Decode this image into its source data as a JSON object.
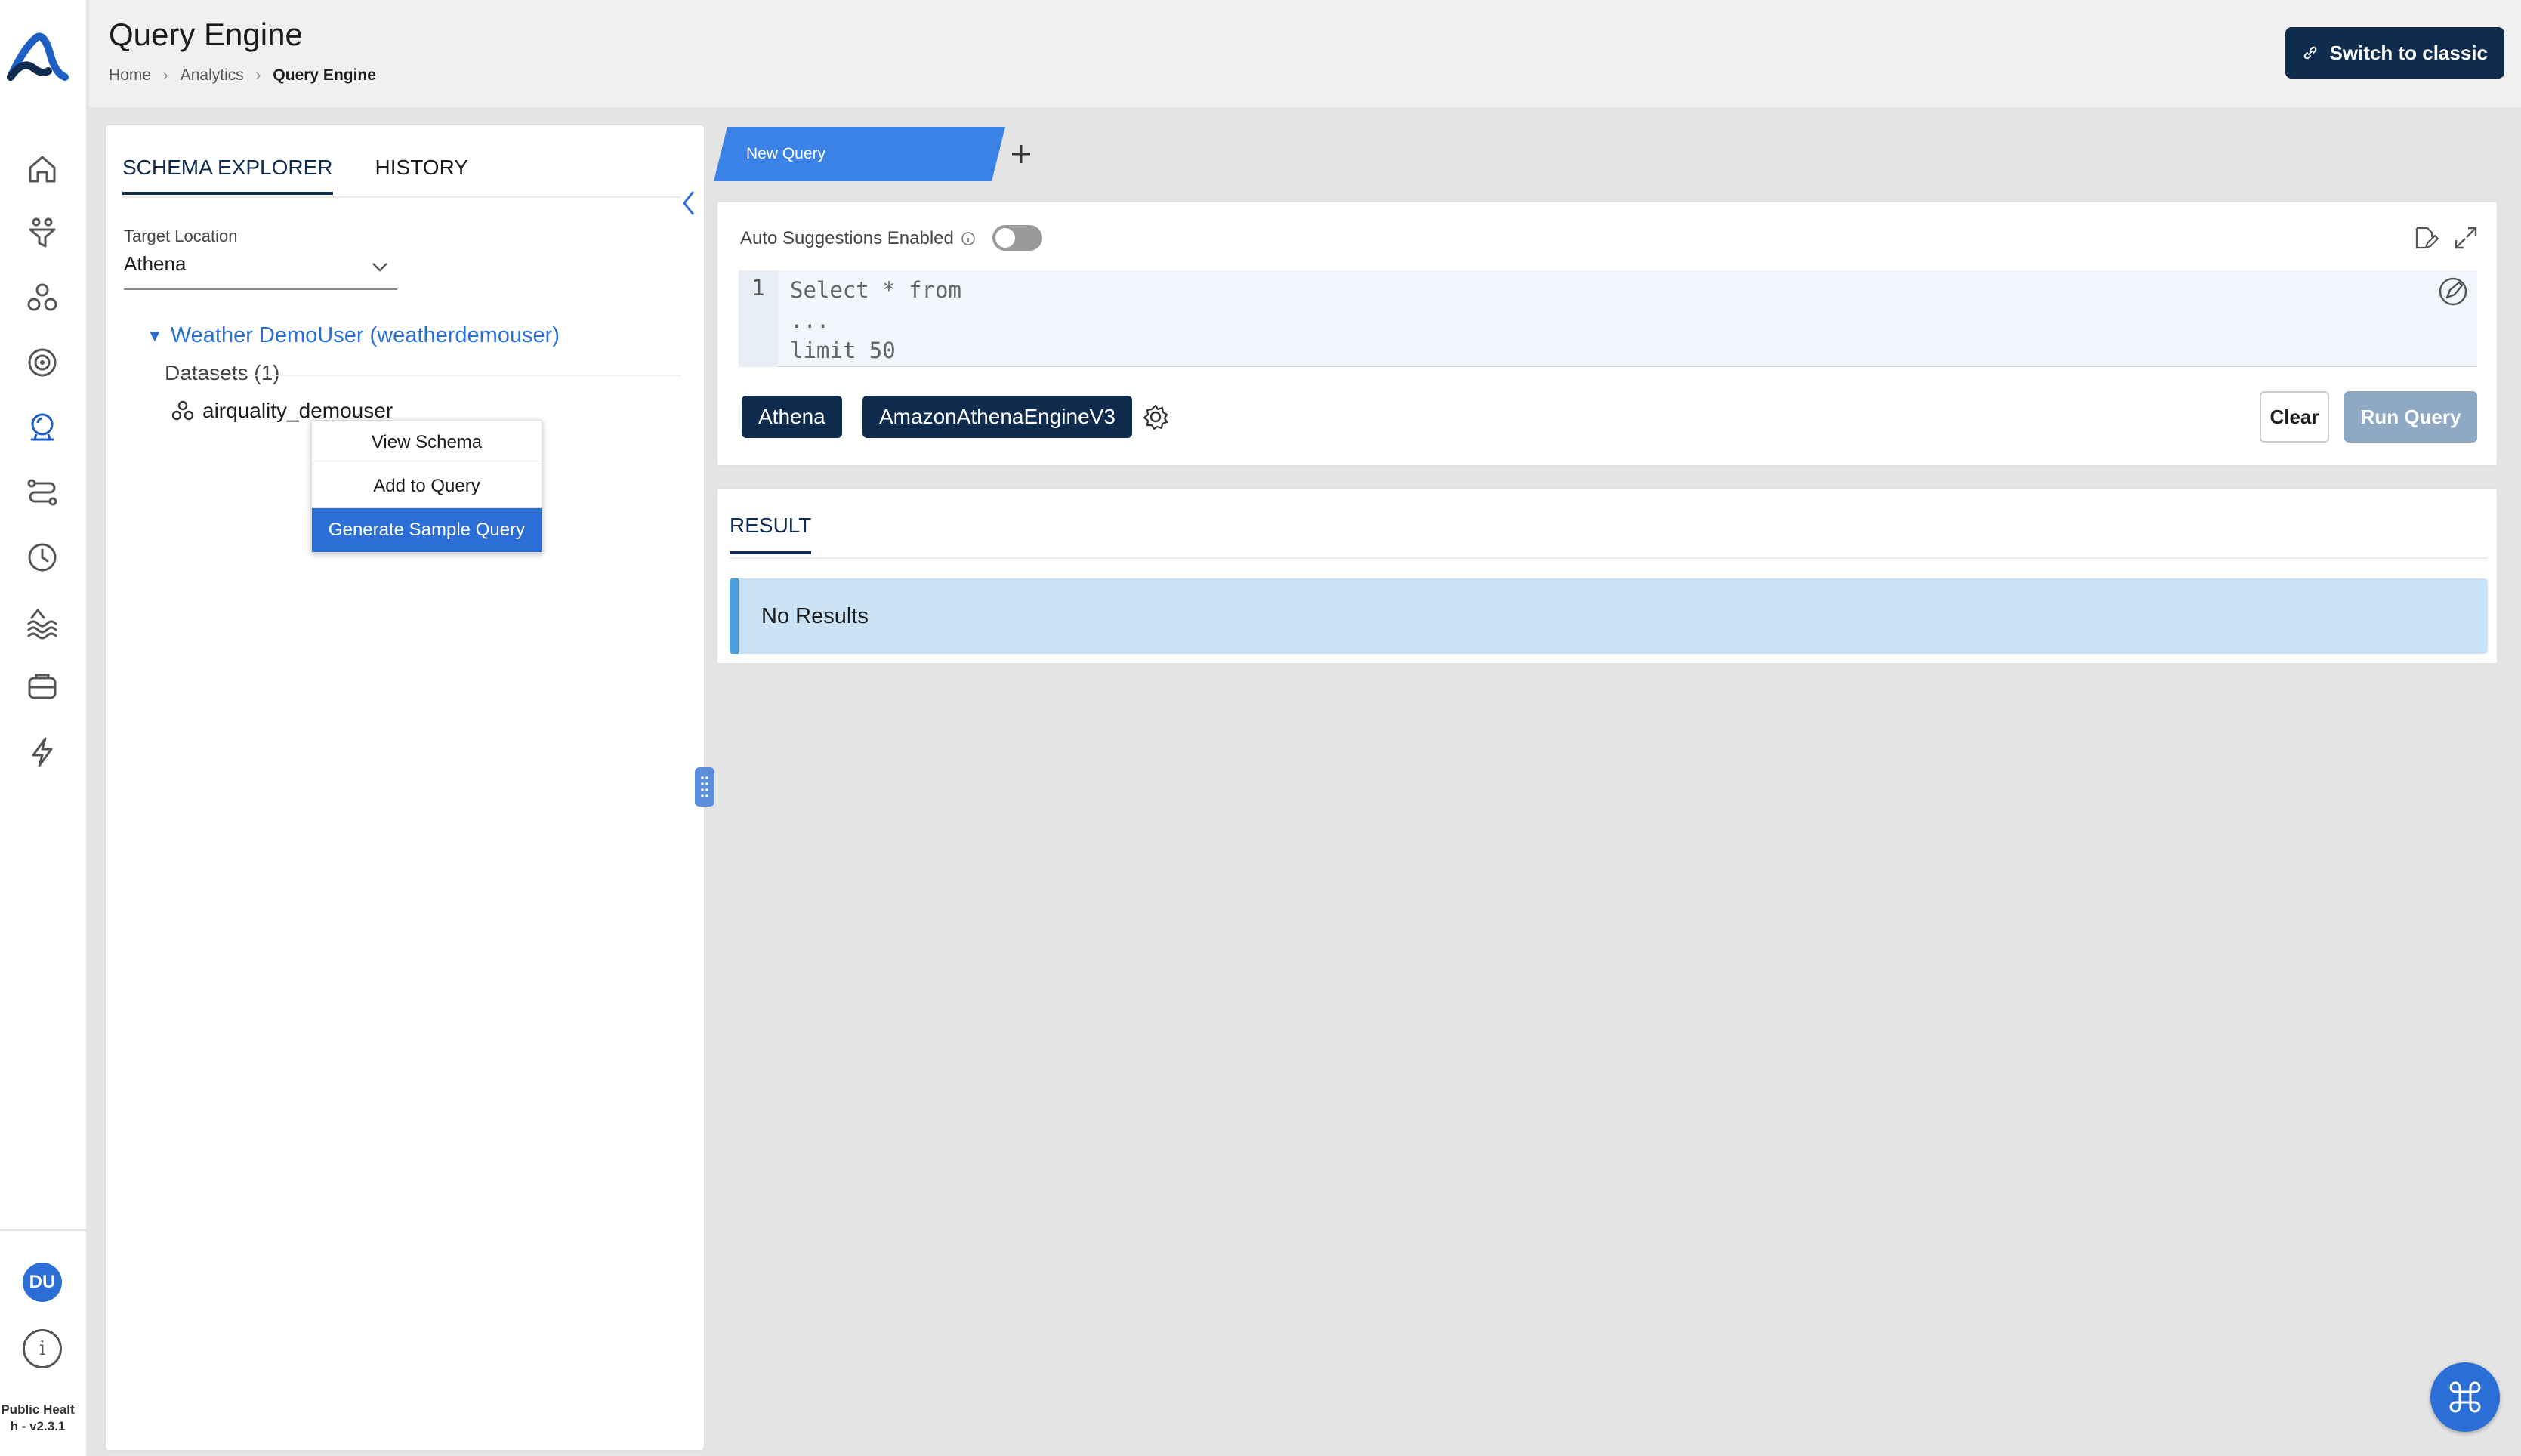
{
  "header": {
    "title": "Query Engine",
    "breadcrumb": [
      "Home",
      "Analytics",
      "Query Engine"
    ],
    "switch_classic_label": "Switch to classic"
  },
  "sidebar": {
    "icons": [
      "home-icon",
      "filter-icon",
      "datasets-icon",
      "target-icon",
      "query-engine-icon",
      "pipeline-icon",
      "clock-icon",
      "data-lake-icon",
      "storage-icon",
      "lightning-icon"
    ],
    "user_initials": "DU",
    "version_text": "Public Health - v2.3.1"
  },
  "schema_panel": {
    "tabs": [
      "SCHEMA EXPLORER",
      "HISTORY"
    ],
    "active_tab": "SCHEMA EXPLORER",
    "target_location_label": "Target Location",
    "target_location_value": "Athena",
    "owner": "Weather DemoUser (weatherdemouser)",
    "datasets_label": "Datasets (1)",
    "dataset_name": "airquality_demouser",
    "context_menu": [
      "View Schema",
      "Add to Query",
      "Generate Sample Query"
    ],
    "context_menu_highlighted": "Generate Sample Query"
  },
  "query": {
    "tab_label": "New Query",
    "auto_suggestions_label": "Auto Suggestions Enabled",
    "auto_suggestions_on": false,
    "line_number": "1",
    "code_lines": [
      "Select * from",
      "...",
      "limit 50"
    ],
    "engine_chips": [
      "Athena",
      "AmazonAthenaEngineV3"
    ],
    "clear_label": "Clear",
    "run_label": "Run Query"
  },
  "result": {
    "tab_label": "RESULT",
    "message": "No Results"
  },
  "colors": {
    "brand_navy": "#0f2b4e",
    "accent_blue": "#2b6fd6",
    "tab_blue": "#3b82e6",
    "info_bg": "#c9e2f5"
  }
}
